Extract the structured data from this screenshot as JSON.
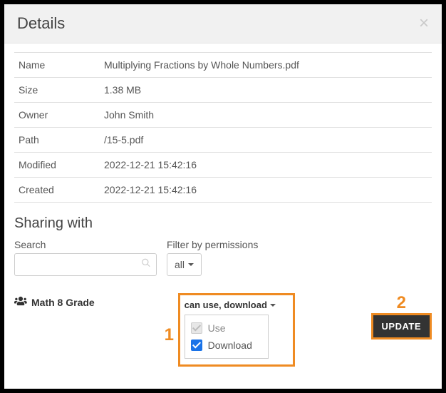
{
  "header": {
    "title": "Details"
  },
  "details": {
    "rows": [
      {
        "key": "Name",
        "value": "Multiplying Fractions by Whole Numbers.pdf"
      },
      {
        "key": "Size",
        "value": "1.38 MB"
      },
      {
        "key": "Owner",
        "value": "John Smith"
      },
      {
        "key": "Path",
        "value": "/15-5.pdf"
      },
      {
        "key": "Modified",
        "value": "2022-12-21 15:42:16"
      },
      {
        "key": "Created",
        "value": "2022-12-21 15:42:16"
      }
    ]
  },
  "sharing": {
    "title": "Sharing with",
    "search_label": "Search",
    "filter_label": "Filter by permissions",
    "filter_value": "all",
    "group": "Math 8 Grade",
    "perm_summary": "can use, download",
    "options": {
      "use": "Use",
      "download": "Download"
    },
    "update": "Update"
  },
  "callouts": {
    "one": "1",
    "two": "2"
  }
}
